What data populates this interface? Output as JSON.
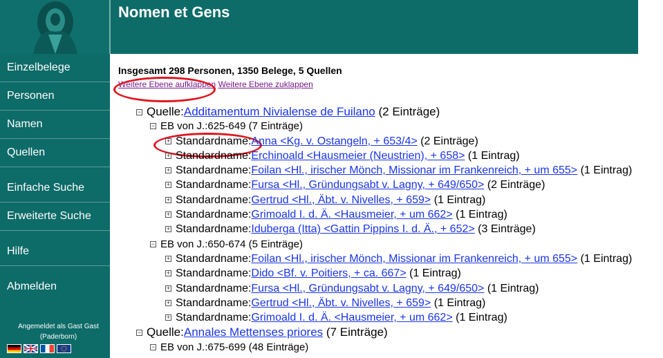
{
  "header": {
    "title": "Nomen et Gens"
  },
  "sidebar": {
    "items": [
      {
        "label": "Einzelbelege"
      },
      {
        "label": "Personen"
      },
      {
        "label": "Namen"
      },
      {
        "label": "Quellen"
      },
      {
        "label": "Einfache Suche"
      },
      {
        "label": "Erweiterte Suche"
      },
      {
        "label": "Hilfe"
      },
      {
        "label": "Abmelden"
      }
    ],
    "login_line1": "Angemeldet als Gast Gast",
    "login_line2": "(Paderborn)",
    "flags": [
      "de",
      "en",
      "fr",
      "eu"
    ]
  },
  "main": {
    "summary": "Insgesamt 298 Personen, 1350 Belege, 5 Quellen",
    "expand_label": "Weitere Ebene aufklappen",
    "collapse_label": "Weitere Ebene zuklappen"
  },
  "tree": {
    "quelle_prefix": "Quelle:",
    "standard_prefix": "Standardname:",
    "q1": {
      "name": "Additamentum Nivialense de Fuilano",
      "count": "(2 Einträge)"
    },
    "eb1": "EB von J.:625-649 (7 Einträge)",
    "eb1_items": [
      {
        "name": "Anna <Kg. v. Ostangeln, + 653/4>",
        "count": "(2 Einträge)"
      },
      {
        "name": "Erchinoald <Hausmeier (Neustrien), + 658>",
        "count": "(1 Eintrag)"
      },
      {
        "name": "Foilan <Hl., irischer Mönch, Missionar im Frankenreich, + um 655>",
        "count": "(1 Eintrag)"
      },
      {
        "name": "Fursa <Hl., Gründungsabt v. Lagny, + 649/650>",
        "count": "(2 Einträge)"
      },
      {
        "name": "Gertrud <Hl., Äbt. v. Nivelles, + 659>",
        "count": "(1 Eintrag)"
      },
      {
        "name": "Grimoald I. d. Ä. <Hausmeier, + um 662>",
        "count": "(1 Eintrag)"
      },
      {
        "name": "Iduberga (Itta) <Gattin Pippins I. d. Ä., + 652>",
        "count": "(3 Einträge)"
      }
    ],
    "eb2": "EB von J.:650-674 (5 Einträge)",
    "eb2_items": [
      {
        "name": "Foilan <Hl., irischer Mönch, Missionar im Frankenreich, + um 655>",
        "count": "(1 Eintrag)"
      },
      {
        "name": "Dido <Bf. v. Poitiers, + ca. 667>",
        "count": "(1 Eintrag)"
      },
      {
        "name": "Fursa <Hl., Gründungsabt v. Lagny, + 649/650>",
        "count": "(1 Eintrag)"
      },
      {
        "name": "Gertrud <Hl., Äbt. v. Nivelles, + 659>",
        "count": "(1 Eintrag)"
      },
      {
        "name": "Grimoald I. d. Ä. <Hausmeier, + um 662>",
        "count": "(1 Eintrag)"
      }
    ],
    "q2": {
      "name": "Annales Mettenses priores",
      "count": "(7 Einträge)"
    },
    "eb3": "EB von J.:675-699 (48 Einträge)"
  }
}
